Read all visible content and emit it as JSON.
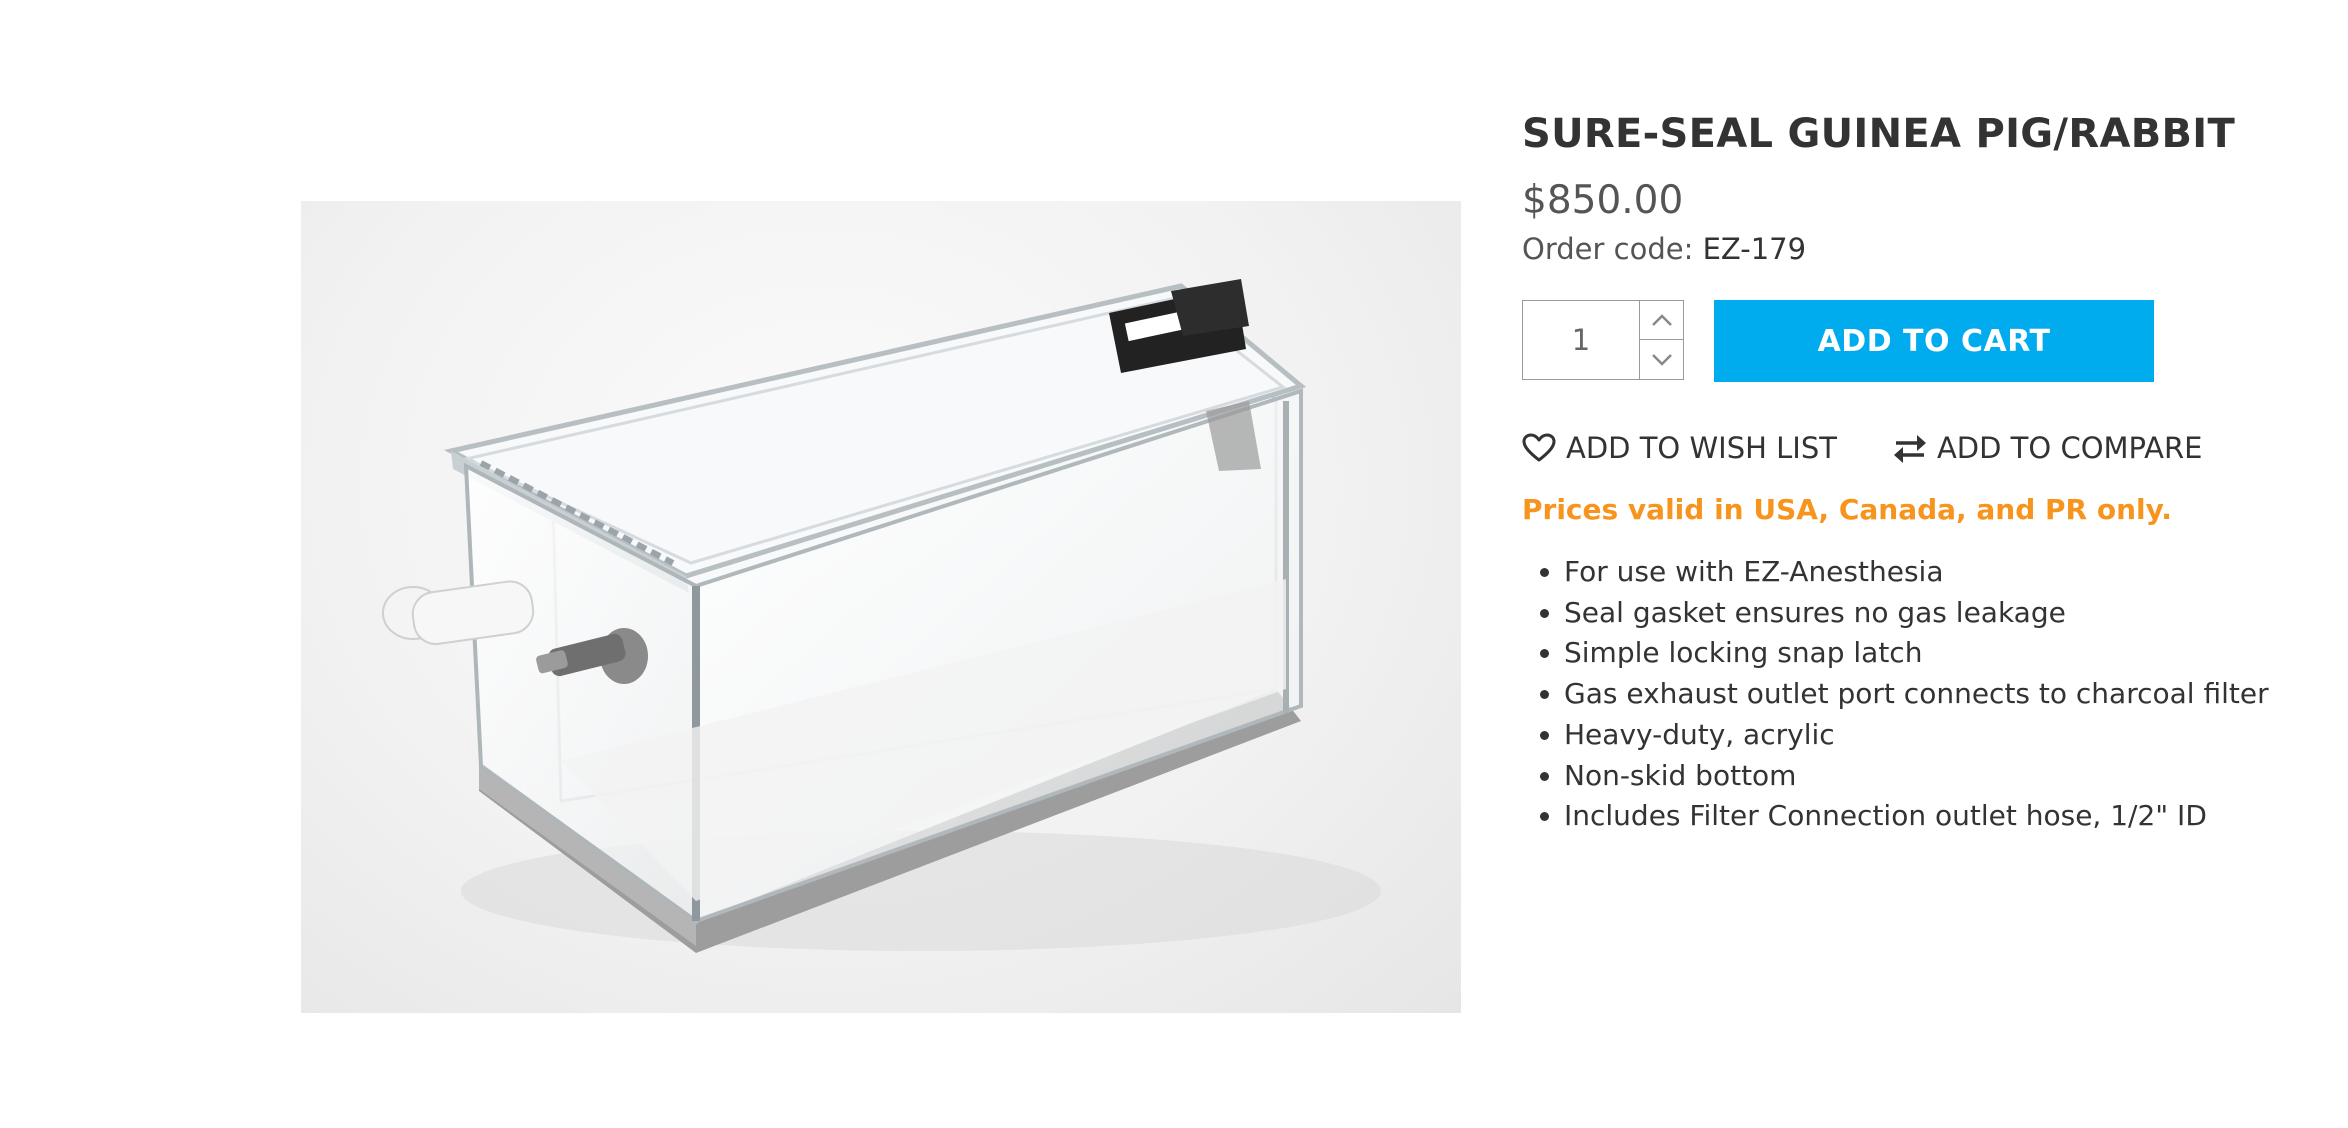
{
  "product": {
    "title": "SURE-SEAL GUINEA PIG/RABBIT",
    "price": "$850.00",
    "order_code_label": "Order code:",
    "order_code_value": "EZ-179",
    "image_icon": "acrylic-induction-chamber-photo"
  },
  "cart": {
    "quantity": "1",
    "add_to_cart_label": "ADD TO CART",
    "button_color": "#00acee"
  },
  "actions": {
    "wish_list_label": "ADD TO WISH LIST",
    "wish_list_icon": "heart-icon",
    "compare_label": "ADD TO COMPARE",
    "compare_icon": "swap-arrows-icon"
  },
  "notice": {
    "text": "Prices valid in USA, Canada, and PR only.",
    "color": "#f7941d"
  },
  "features": [
    "For use with EZ-Anesthesia",
    "Seal gasket ensures no gas leakage",
    "Simple locking snap latch",
    "Gas exhaust outlet port connects to charcoal filter",
    "Heavy-duty, acrylic",
    "Non-skid bottom",
    "Includes Filter Connection outlet hose, 1/2\" ID"
  ]
}
